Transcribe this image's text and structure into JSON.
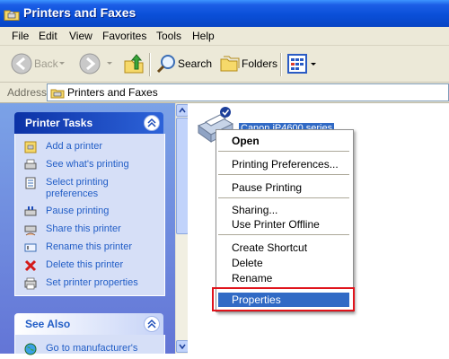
{
  "window": {
    "title": "Printers and Faxes",
    "title_icon": "printers-folder-icon"
  },
  "menubar": {
    "items": [
      "File",
      "Edit",
      "View",
      "Favorites",
      "Tools",
      "Help"
    ]
  },
  "toolbar": {
    "back_label": "Back",
    "search_label": "Search",
    "folders_label": "Folders",
    "icons": [
      "back-arrow-icon",
      "forward-arrow-icon",
      "up-folder-icon",
      "search-icon",
      "folders-icon",
      "views-icon"
    ]
  },
  "address": {
    "label": "Address",
    "value": "Printers and Faxes"
  },
  "left_pane": {
    "printer_tasks": {
      "title": "Printer Tasks",
      "items": [
        {
          "label": "Add a printer",
          "icon": "add-printer-icon"
        },
        {
          "label": "See what's printing",
          "icon": "print-queue-icon"
        },
        {
          "label": "Select printing",
          "label2": "preferences",
          "icon": "preferences-icon"
        },
        {
          "label": "Pause printing",
          "icon": "pause-printer-icon"
        },
        {
          "label": "Share this printer",
          "icon": "share-printer-icon"
        },
        {
          "label": "Rename this printer",
          "icon": "rename-icon"
        },
        {
          "label": "Delete this printer",
          "icon": "delete-x-icon"
        },
        {
          "label": "Set printer properties",
          "icon": "printer-properties-icon"
        }
      ]
    },
    "see_also": {
      "title": "See Also",
      "items": [
        {
          "label": "Go to manufacturer's",
          "icon": "web-globe-icon"
        }
      ]
    }
  },
  "main": {
    "printer_name": "Canon iP4600 series",
    "printer_icon": "default-printer-icon"
  },
  "context_menu": {
    "items": [
      {
        "label": "Open",
        "bold": true
      },
      {
        "label": "Printing Preferences..."
      },
      {
        "label": "Pause Printing"
      },
      {
        "label": "Sharing..."
      },
      {
        "label": "Use Printer Offline"
      },
      {
        "label": "Create Shortcut"
      },
      {
        "label": "Delete"
      },
      {
        "label": "Rename"
      },
      {
        "label": "Properties",
        "selected": true
      }
    ]
  },
  "colors": {
    "title_bar": "#0a4fd8",
    "selection": "#316ac5",
    "highlight_box": "#e0141c",
    "task_link": "#215dc6"
  }
}
